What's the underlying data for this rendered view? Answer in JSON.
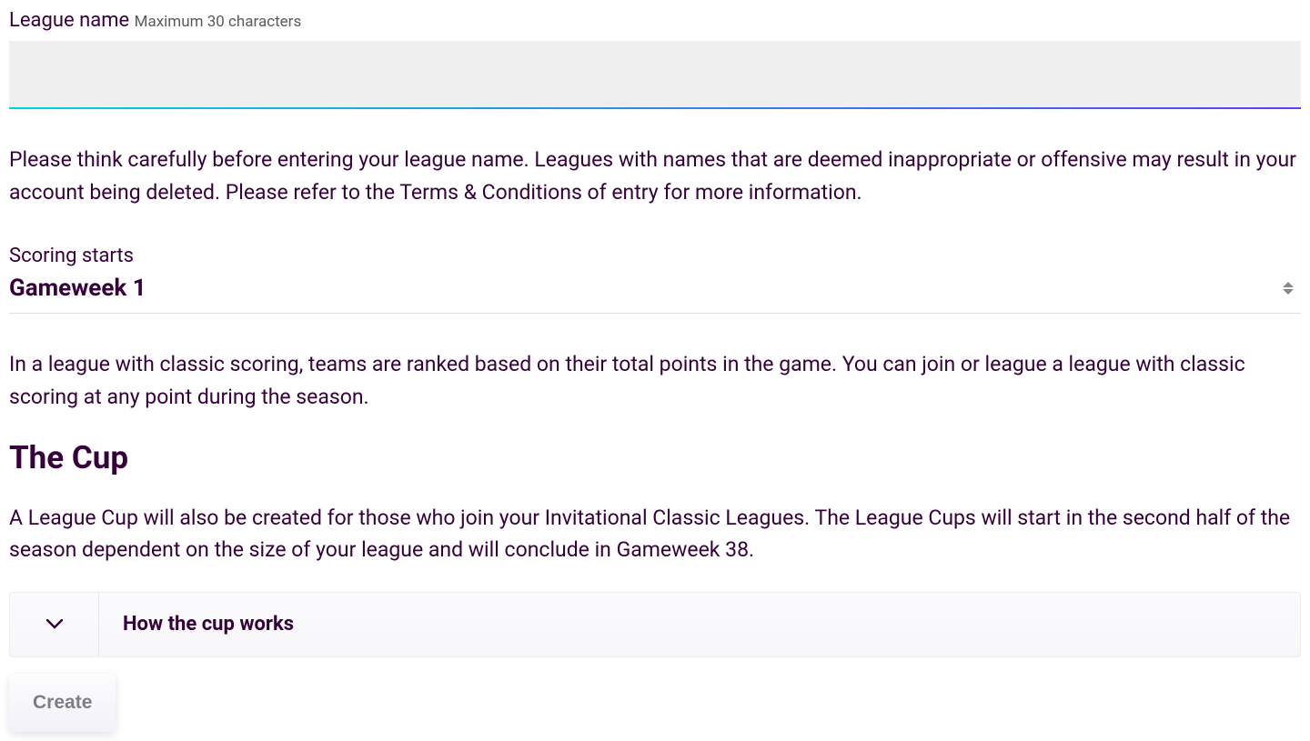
{
  "leagueName": {
    "label": "League name",
    "hint": "Maximum 30 characters",
    "value": ""
  },
  "warningText": "Please think carefully before entering your league name. Leagues with names that are deemed inappropriate or offensive may result in your account being deleted. Please refer to the Terms & Conditions of entry for more information.",
  "scoringStarts": {
    "label": "Scoring starts",
    "selected": "Gameweek 1"
  },
  "scoringDescription": "In a league with classic scoring, teams are ranked based on their total points in the game. You can join or league a league with classic scoring at any point during the season.",
  "cup": {
    "heading": "The Cup",
    "description": "A League Cup will also be created for those who join your Invitational Classic Leagues. The League Cups will start in the second half of the season dependent on the size of your league and will conclude in Gameweek 38.",
    "accordionTitle": "How the cup works"
  },
  "createButton": "Create"
}
